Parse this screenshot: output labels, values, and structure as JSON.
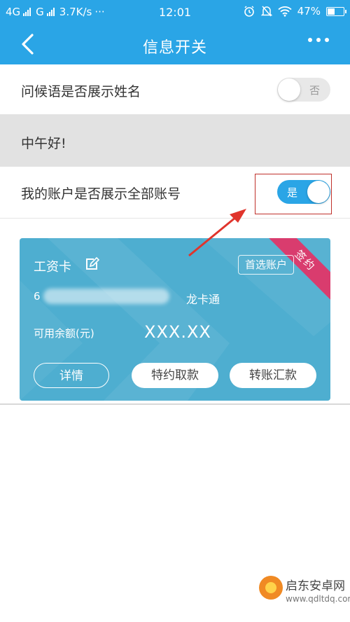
{
  "status_bar": {
    "network": "4G",
    "network2": "G",
    "speed": "3.7K/s",
    "extra": "···",
    "time": "12:01",
    "battery": "47%",
    "battery_level": 0.47,
    "icons": [
      "alarm-icon",
      "mute-icon",
      "wifi-icon",
      "battery-icon"
    ]
  },
  "nav": {
    "title": "信息开关",
    "back_icon": "chevron-left-icon",
    "more_icon": "more-dots-icon"
  },
  "settings": {
    "show_name": {
      "label": "问候语是否展示姓名",
      "toggle_text": "否",
      "enabled": false
    },
    "greeting_preview": "中午好!",
    "show_all_accounts": {
      "label": "我的账户是否展示全部账号",
      "toggle_text": "是",
      "enabled": true
    }
  },
  "card": {
    "title": "工资卡",
    "ribbon": "签约",
    "preferred_button": "首选账户",
    "account_number_visible": "6",
    "account_type": "龙卡通",
    "balance_label": "可用余额(元)",
    "balance_value": "XXX.XX",
    "buttons": {
      "details": "详情",
      "withdraw": "特约取款",
      "transfer": "转账汇款"
    }
  },
  "colors": {
    "primary": "#2aa5e6",
    "card": "#4eaed0",
    "ribbon": "#d93c6e",
    "annotation": "#c0312b"
  },
  "watermark": {
    "name": "启东安卓网",
    "url": "www.qdltdq.com"
  }
}
